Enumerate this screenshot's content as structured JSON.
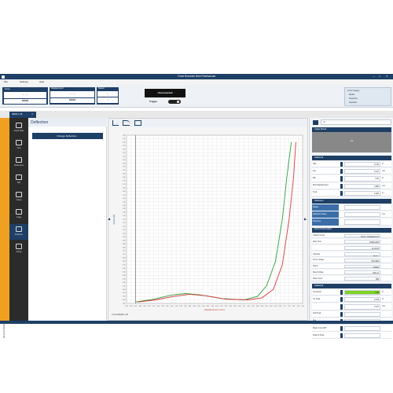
{
  "window": {
    "title": "Force Recorder Next Professional"
  },
  "menu": [
    "File",
    "Settings",
    "Help"
  ],
  "toolbar": {
    "force": {
      "label": "Force",
      "value": "-- . --",
      "zero": "ZERO"
    },
    "displacement": {
      "label": "Displacement",
      "value": "-- . --",
      "zero": "ZERO"
    },
    "speed": {
      "label": "Speed",
      "value": "--",
      "sub": "--"
    },
    "connection_status": "Unconnected",
    "trigger_label": "Trigger",
    "info_lines": [
      "Force Gauge",
      "Model",
      "Serial No.",
      "Operator"
    ]
  },
  "device_tab": "ZEDD-1-Z8",
  "sidebar": {
    "vertical_label": "Record Settings",
    "items": [
      {
        "label": "Graph Table",
        "icon": "graph-table-icon"
      },
      {
        "label": "View",
        "icon": "view-chart-icon"
      },
      {
        "label": "Parameters",
        "icon": "monitor-icon"
      },
      {
        "label": "Edit",
        "icon": "edit-icon"
      },
      {
        "label": "Output",
        "icon": "trash-icon"
      },
      {
        "label": "Judge",
        "icon": "judge-icon"
      },
      {
        "label": "Deflection",
        "icon": "deflection-icon"
      },
      {
        "label": "Spring",
        "icon": "spring-icon"
      }
    ],
    "active_index": 6
  },
  "deflection_panel": {
    "title": "Deflection",
    "button": "Change Deflection..."
  },
  "chart_toolbar": {
    "icons": [
      "graph-icon",
      "curve-icon",
      "image-icon"
    ]
  },
  "chart_data": {
    "type": "line",
    "title": "",
    "xlabel": "Displacement (mm)",
    "ylabel": "Force (N)",
    "xlim": [
      0,
      7.8
    ],
    "ylim": [
      0,
      2.4
    ],
    "grid": true,
    "series": [
      {
        "color": "#2e9e3a",
        "x": [
          0.4,
          1.2,
          2.0,
          2.6,
          3.3,
          4.2,
          5.2,
          5.8,
          6.2,
          6.6,
          6.9,
          7.1,
          7.3
        ],
        "y": [
          0.02,
          0.06,
          0.12,
          0.14,
          0.12,
          0.07,
          0.05,
          0.1,
          0.25,
          0.6,
          1.2,
          1.8,
          2.3
        ]
      },
      {
        "color": "#d83a3a",
        "x": [
          0.5,
          1.3,
          2.1,
          2.8,
          3.5,
          4.4,
          5.4,
          6.0,
          6.5,
          6.9,
          7.2,
          7.4,
          7.5
        ],
        "y": [
          0.02,
          0.05,
          0.1,
          0.13,
          0.11,
          0.06,
          0.05,
          0.08,
          0.2,
          0.55,
          1.2,
          1.8,
          2.3
        ]
      }
    ]
  },
  "file_path": "C:\\work\\ZEDD-1-Z8",
  "right_panel": {
    "search_placeholder": "All",
    "judge_result": {
      "title": "Judge Result",
      "value": "--"
    },
    "statistical": {
      "title": "Statistical",
      "rows": [
        {
          "label": "Max",
          "value": "27.82",
          "unit": "N"
        },
        {
          "label": "Ave",
          "value": "2.127",
          "unit": "mm"
        },
        {
          "label": "Min",
          "value": "0.00",
          "unit": "N"
        },
        {
          "label": "Max Displacement",
          "value": "0.895",
          "unit": "mm"
        },
        {
          "label": "Final",
          "value": "4.925",
          "unit": "N"
        }
      ]
    },
    "deflection": {
      "title": "Deflection",
      "rows": [
        {
          "label": "Range",
          "value": "",
          "unit": ""
        },
        {
          "label": "Deflection Value",
          "value": "",
          "unit": "mm"
        },
        {
          "label": "Tolerance",
          "value": "",
          "unit": ""
        }
      ]
    },
    "record_info": {
      "title": "Record Information",
      "rows": [
        {
          "label": "Graph Format",
          "value": "Force - Displacement"
        },
        {
          "label": "Start Time",
          "value": "2024/12/05"
        },
        {
          "label": "",
          "value": "11:20:03"
        },
        {
          "label": "Operator",
          "value": "テスト"
        },
        {
          "label": "Force Gauge",
          "value": "ZTA-50N"
        },
        {
          "label": "Stand",
          "value": "TCD01"
        },
        {
          "label": "Record Rate",
          "value": "400 ms"
        },
        {
          "label": "Data Count",
          "value": "500"
        }
      ]
    },
    "statistical2": {
      "title": "Statistical",
      "rows": [
        {
          "label": "Threshold",
          "value": "0.00",
          "unit": "N"
        },
        {
          "label": "1st Peak",
          "value": "27.82",
          "unit": "N"
        },
        {
          "label": "",
          "value": "2.127",
          "unit": "mm"
        },
        {
          "label": "2nd Peak",
          "value": "",
          "unit": ""
        },
        {
          "label": "Ave",
          "value": "",
          "unit": ""
        },
        {
          "label": "Mean Force Diff",
          "value": "",
          "unit": ""
        },
        {
          "label": "Peak to Peak",
          "value": "",
          "unit": ""
        }
      ]
    }
  }
}
